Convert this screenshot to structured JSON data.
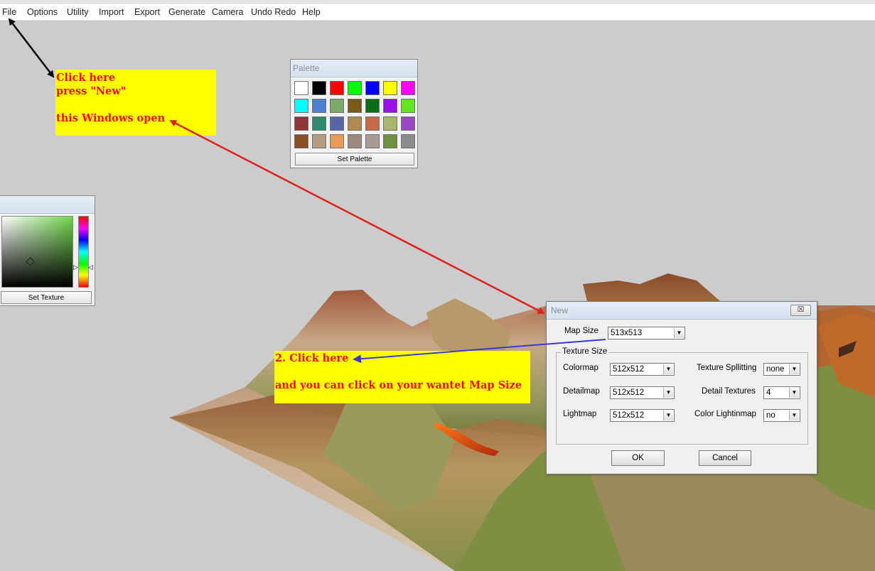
{
  "menubar": {
    "items": [
      "File",
      "Options",
      "Utility",
      "Import",
      "Export",
      "Generate",
      "Camera",
      "Undo Redo",
      "Help"
    ]
  },
  "palette": {
    "title": "Palette",
    "swatches": [
      "#ffffff",
      "#000000",
      "#ff0000",
      "#00ff00",
      "#0000ff",
      "#ffff00",
      "#ff00ff",
      "#00ffff",
      "#4e7fd0",
      "#7ea86a",
      "#7a5a18",
      "#0a6e16",
      "#9a10e6",
      "#62e61e",
      "#8e3636",
      "#2e8c6a",
      "#5864a6",
      "#b08a50",
      "#c86a48",
      "#a9b66e",
      "#9a48c8",
      "#8a5026",
      "#b39c80",
      "#e89a58",
      "#9a8a80",
      "#a89a94",
      "#6e9040",
      "#8c8c8c"
    ],
    "button_label": "Set Palette"
  },
  "texture_panel": {
    "button_label": "Set Texture"
  },
  "notes": {
    "note1": [
      "Click here",
      "press \"New\"",
      "",
      "this Windows open"
    ],
    "note2": [
      "2.  Click here",
      "",
      "and you can click on your wantet Map Size"
    ]
  },
  "dialog": {
    "title": "New",
    "close_symbol": "☒",
    "map_size_label": "Map Size",
    "map_size_value": "513x513",
    "group_label": "Texture Size",
    "colormap_label": "Colormap",
    "colormap_value": "512x512",
    "detailmap_label": "Detailmap",
    "detailmap_value": "512x512",
    "lightmap_label": "Lightmap",
    "lightmap_value": "512x512",
    "texture_splitting_label": "Texture Spllitting",
    "texture_splitting_value": "none",
    "detail_textures_label": "Detail Textures",
    "detail_textures_value": "4",
    "color_lightmap_label": "Color  Lightinmap",
    "color_lightmap_value": "no",
    "ok_label": "OK",
    "cancel_label": "Cancel"
  },
  "colors": {
    "note_bg": "#ffff00",
    "note_text": "#e81010",
    "arrow_red": "#e02020",
    "arrow_blue": "#3a3ad0",
    "arrow_black": "#000000"
  }
}
